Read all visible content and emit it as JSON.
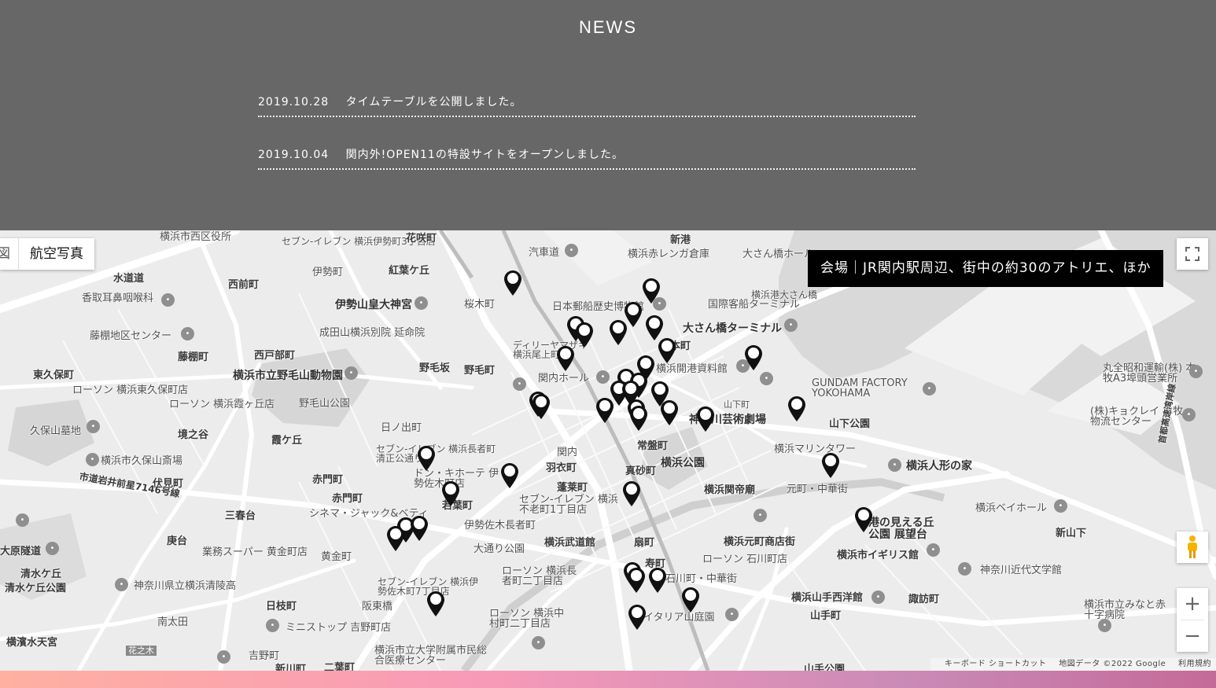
{
  "news": {
    "heading": "NEWS",
    "items": [
      {
        "date": "2019.10.28",
        "text": "タイムテーブルを公開しました。"
      },
      {
        "date": "2019.10.04",
        "text": "関内外!OPEN11の特設サイトをオープンしました。"
      }
    ]
  },
  "map": {
    "type_control": {
      "map_partial": "図",
      "satellite": "航空写真"
    },
    "venue_label": "会場｜JR関内駅周辺、街中の約30のアトリエ、ほか",
    "zoom_in": "+",
    "zoom_out": "−",
    "attribution": {
      "shortcuts": "キーボード ショートカット",
      "data": "地図データ ©2022 Google",
      "terms": "利用規約"
    },
    "labels": [
      "横浜市西区役所",
      "セブン-イレブン 横浜伊勢町3丁目店",
      "花咲町",
      "新港",
      "汽車道",
      "横浜赤レンガ倉庫",
      "大さん橋ホール",
      "水道道",
      "西前町",
      "伊勢町",
      "紅葉ケ丘",
      "伊勢山皇大神宮",
      "日本郵船歴史博物館",
      "香取耳鼻咽喉科",
      "桜木町",
      "国際客船ターミナル",
      "横浜港大さん橋",
      "大さん橋ターミナル",
      "藤棚地区センター",
      "成田山横浜別院 延命院",
      "藤棚町",
      "西戸部町",
      "ディリーヤマザキ 横浜尾上町店",
      "本町",
      "横浜開港資料館",
      "東久保町",
      "野毛坂",
      "野毛町",
      "関内ホール",
      "横浜市立野毛山動物園",
      "ローソン 横浜東久保町店",
      "ローソン 横浜霞ヶ丘店",
      "野毛山公園",
      "GUNDAM FACTORY YOKOHAMA",
      "丸全昭和運輸(株) 本牧A3埠頭営業所",
      "(株)キョクレイ 本牧物流センター",
      "久保山墓地",
      "境之谷",
      "霞ケ丘",
      "日ノ出町",
      "神奈川芸術劇場",
      "山下公園",
      "横浜市久保山斎場",
      "セブン-イレブン 横浜長者町清正公通り店",
      "関内",
      "横浜マリンタワー",
      "常盤町",
      "横浜人形の家",
      "赤門町",
      "ドン・キホーテ 伊勢佐木町店",
      "羽衣町",
      "真砂町",
      "横浜公園",
      "蓬莱町",
      "伏見町",
      "市道岩井前星7146号線",
      "横浜関帝廟",
      "元町・中華街",
      "赤門町",
      "若葉町",
      "セブン-イレブン 横浜不老町1丁目店",
      "横浜ベイホール",
      "三春台",
      "シネマ・ジャック&ベティ",
      "伊勢佐木長者町",
      "港の見える丘公園 展望台",
      "新山下",
      "庚台",
      "大通り公園",
      "横浜武道館",
      "扇町",
      "横浜元町商店街",
      "横浜市イギリス館",
      "大原隧道",
      "業務スーパー 黄金町店",
      "黄金町",
      "寿町",
      "ローソン 石川町店",
      "神奈川近代文学館",
      "清水ケ丘",
      "清水ケ丘公園",
      "神奈川県立横浜清陵高",
      "セブン-イレブン 横浜伊勢佐木町7丁目店",
      "ローソン 横浜長者町二丁目店",
      "石川町・中華街",
      "日枝町",
      "阪東橋",
      "横浜山手西洋館",
      "諏訪町",
      "南太田",
      "ミニストップ 吉野町店",
      "ローソン 横浜中村町二丁目店",
      "イタリア山庭園",
      "山手町",
      "横濱水天宮",
      "花之木",
      "吉野町",
      "横浜市立大学附属市民総合医療センター",
      "新川町",
      "二葉町",
      "山手公園",
      "横浜市立みなと赤十字病院",
      "首都高速湾岸線",
      "山下町"
    ]
  }
}
